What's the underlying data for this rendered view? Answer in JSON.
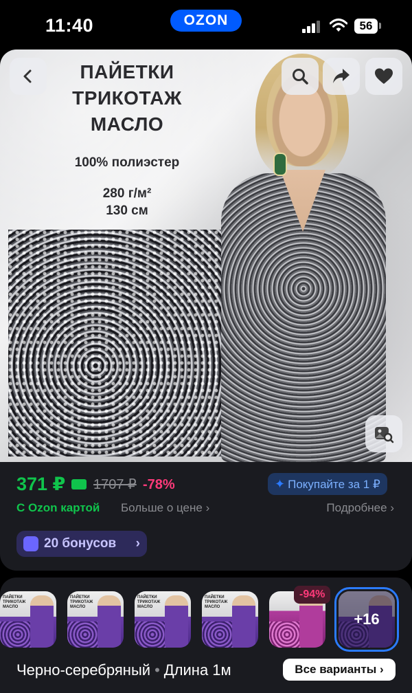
{
  "status_bar": {
    "time": "11:40",
    "brand": "OZON",
    "battery": "56"
  },
  "product_image": {
    "promo_title_line1": "ПАЙЕТКИ",
    "promo_title_line2": "ТРИКОТАЖ",
    "promo_title_line3": "МАСЛО",
    "composition": "100% полиэстер",
    "density": "280 г/м²",
    "width": "130 см"
  },
  "price": {
    "current": "371 ₽",
    "old": "1707 ₽",
    "discount": "-78%",
    "card_label": "С Ozon картой",
    "more_about_price": "Больше о цене",
    "buy_for": "Покупайте за 1 ₽",
    "details": "Подробнее"
  },
  "bonus": {
    "label": "20 бонусов"
  },
  "variants": {
    "thumb_title_line1": "ПАЙЕТКИ",
    "thumb_title_line2": "ТРИКОТАЖ",
    "thumb_title_line3": "МАСЛО",
    "thumb_badge": "-94%",
    "more_count": "+16",
    "color": "Черно-серебряный",
    "separator": "•",
    "length": "Длина 1м",
    "all_button": "Все варианты"
  },
  "colors": {
    "brand_blue": "#005bff",
    "price_green": "#10c44c",
    "discount_pink": "#ff3a7a",
    "bonus_purple": "#2d2a5a"
  }
}
